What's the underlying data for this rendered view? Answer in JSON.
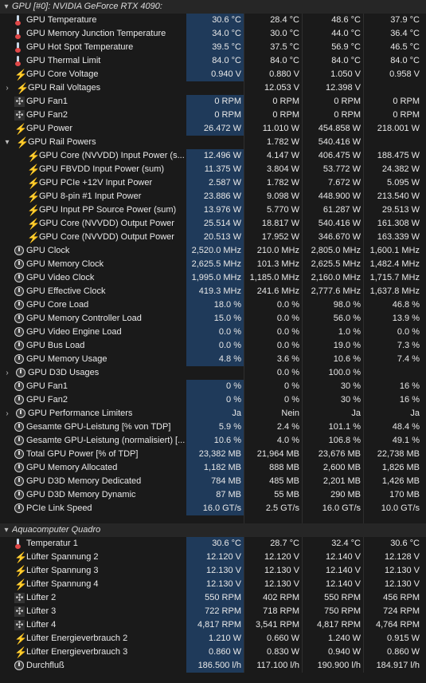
{
  "icons": {
    "temp": "thermometer-icon",
    "volt": "lightning-bolt-icon",
    "fan": "fan-icon",
    "clock": "clock-icon",
    "chevron_down": "chevron-down-icon",
    "chevron_right": "chevron-right-icon"
  },
  "colors": {
    "background": "#1a1a1a",
    "current_highlight": "#1f3a5a",
    "bolt": "#f2c300",
    "thermo_bulb": "#e04848"
  },
  "rows": [
    {
      "t": "sec",
      "lvl": 0,
      "exp": "▾",
      "name": "GPU [#0]: NVIDIA GeForce RTX 4090:"
    },
    {
      "t": "r",
      "lvl": 1,
      "icon": "temp",
      "name": "GPU Temperature",
      "v": [
        "30.6 °C",
        "28.4 °C",
        "48.6 °C",
        "37.9 °C"
      ]
    },
    {
      "t": "r",
      "lvl": 1,
      "icon": "temp",
      "name": "GPU Memory Junction Temperature",
      "v": [
        "34.0 °C",
        "30.0 °C",
        "44.0 °C",
        "36.4 °C"
      ]
    },
    {
      "t": "r",
      "lvl": 1,
      "icon": "temp",
      "name": "GPU Hot Spot Temperature",
      "v": [
        "39.5 °C",
        "37.5 °C",
        "56.9 °C",
        "46.5 °C"
      ]
    },
    {
      "t": "r",
      "lvl": 1,
      "icon": "temp",
      "name": "GPU Thermal Limit",
      "v": [
        "84.0 °C",
        "84.0 °C",
        "84.0 °C",
        "84.0 °C"
      ]
    },
    {
      "t": "r",
      "lvl": 1,
      "icon": "volt",
      "name": "GPU Core Voltage",
      "v": [
        "0.940 V",
        "0.880 V",
        "1.050 V",
        "0.958 V"
      ]
    },
    {
      "t": "r",
      "lvl": 1,
      "exp": "›",
      "icon": "volt",
      "name": "GPU Rail Voltages",
      "v": [
        "",
        "12.053 V",
        "12.398 V",
        ""
      ]
    },
    {
      "t": "r",
      "lvl": 1,
      "icon": "fan",
      "name": "GPU Fan1",
      "v": [
        "0 RPM",
        "0 RPM",
        "0 RPM",
        "0 RPM"
      ]
    },
    {
      "t": "r",
      "lvl": 1,
      "icon": "fan",
      "name": "GPU Fan2",
      "v": [
        "0 RPM",
        "0 RPM",
        "0 RPM",
        "0 RPM"
      ]
    },
    {
      "t": "r",
      "lvl": 1,
      "icon": "volt",
      "name": "GPU Power",
      "v": [
        "26.472 W",
        "11.010 W",
        "454.858 W",
        "218.001 W"
      ]
    },
    {
      "t": "r",
      "lvl": 1,
      "exp": "▾",
      "icon": "volt",
      "name": "GPU Rail Powers",
      "v": [
        "",
        "1.782 W",
        "540.416 W",
        ""
      ]
    },
    {
      "t": "r",
      "lvl": 2,
      "icon": "volt",
      "name": "GPU Core (NVVDD) Input Power (s...",
      "v": [
        "12.496 W",
        "4.147 W",
        "406.475 W",
        "188.475 W"
      ]
    },
    {
      "t": "r",
      "lvl": 2,
      "icon": "volt",
      "name": "GPU FBVDD Input Power (sum)",
      "v": [
        "11.375 W",
        "3.804 W",
        "53.772 W",
        "24.382 W"
      ]
    },
    {
      "t": "r",
      "lvl": 2,
      "icon": "volt",
      "name": "GPU PCIe +12V Input Power",
      "v": [
        "2.587 W",
        "1.782 W",
        "7.672 W",
        "5.095 W"
      ]
    },
    {
      "t": "r",
      "lvl": 2,
      "icon": "volt",
      "name": "GPU 8-pin #1 Input Power",
      "v": [
        "23.886 W",
        "9.098 W",
        "448.900 W",
        "213.540 W"
      ]
    },
    {
      "t": "r",
      "lvl": 2,
      "icon": "volt",
      "name": "GPU Input PP Source Power (sum)",
      "v": [
        "13.976 W",
        "5.770 W",
        "61.287 W",
        "29.513 W"
      ]
    },
    {
      "t": "r",
      "lvl": 2,
      "icon": "volt",
      "name": "GPU Core (NVVDD) Output Power",
      "v": [
        "25.514 W",
        "18.817 W",
        "540.416 W",
        "161.308 W"
      ]
    },
    {
      "t": "r",
      "lvl": 2,
      "icon": "volt",
      "name": "GPU Core (NVVDD) Output Power",
      "v": [
        "20.513 W",
        "17.952 W",
        "346.670 W",
        "163.339 W"
      ]
    },
    {
      "t": "r",
      "lvl": 1,
      "icon": "clock",
      "name": "GPU Clock",
      "v": [
        "2,520.0 MHz",
        "210.0 MHz",
        "2,805.0 MHz",
        "1,600.1 MHz"
      ]
    },
    {
      "t": "r",
      "lvl": 1,
      "icon": "clock",
      "name": "GPU Memory Clock",
      "v": [
        "2,625.5 MHz",
        "101.3 MHz",
        "2,625.5 MHz",
        "1,482.4 MHz"
      ]
    },
    {
      "t": "r",
      "lvl": 1,
      "icon": "clock",
      "name": "GPU Video Clock",
      "v": [
        "1,995.0 MHz",
        "1,185.0 MHz",
        "2,160.0 MHz",
        "1,715.7 MHz"
      ]
    },
    {
      "t": "r",
      "lvl": 1,
      "icon": "clock",
      "name": "GPU Effective Clock",
      "v": [
        "419.3 MHz",
        "241.6 MHz",
        "2,777.6 MHz",
        "1,637.8 MHz"
      ]
    },
    {
      "t": "r",
      "lvl": 1,
      "icon": "clock",
      "name": "GPU Core Load",
      "v": [
        "18.0 %",
        "0.0 %",
        "98.0 %",
        "46.8 %"
      ]
    },
    {
      "t": "r",
      "lvl": 1,
      "icon": "clock",
      "name": "GPU Memory Controller Load",
      "v": [
        "15.0 %",
        "0.0 %",
        "56.0 %",
        "13.9 %"
      ]
    },
    {
      "t": "r",
      "lvl": 1,
      "icon": "clock",
      "name": "GPU Video Engine Load",
      "v": [
        "0.0 %",
        "0.0 %",
        "1.0 %",
        "0.0 %"
      ]
    },
    {
      "t": "r",
      "lvl": 1,
      "icon": "clock",
      "name": "GPU Bus Load",
      "v": [
        "0.0 %",
        "0.0 %",
        "19.0 %",
        "7.3 %"
      ]
    },
    {
      "t": "r",
      "lvl": 1,
      "icon": "clock",
      "name": "GPU Memory Usage",
      "v": [
        "4.8 %",
        "3.6 %",
        "10.6 %",
        "7.4 %"
      ]
    },
    {
      "t": "r",
      "lvl": 1,
      "exp": "›",
      "icon": "clock",
      "name": "GPU D3D Usages",
      "v": [
        "",
        "0.0 %",
        "100.0 %",
        ""
      ]
    },
    {
      "t": "r",
      "lvl": 1,
      "icon": "clock",
      "name": "GPU Fan1",
      "v": [
        "0 %",
        "0 %",
        "30 %",
        "16 %"
      ]
    },
    {
      "t": "r",
      "lvl": 1,
      "icon": "clock",
      "name": "GPU Fan2",
      "v": [
        "0 %",
        "0 %",
        "30 %",
        "16 %"
      ]
    },
    {
      "t": "r",
      "lvl": 1,
      "exp": "›",
      "icon": "clock",
      "name": "GPU Performance Limiters",
      "v": [
        "Ja",
        "Nein",
        "Ja",
        "Ja"
      ]
    },
    {
      "t": "r",
      "lvl": 1,
      "icon": "clock",
      "name": "Gesamte GPU-Leistung [% von TDP]",
      "v": [
        "5.9 %",
        "2.4 %",
        "101.1 %",
        "48.4 %"
      ]
    },
    {
      "t": "r",
      "lvl": 1,
      "icon": "clock",
      "name": "Gesamte GPU-Leistung (normalisiert) [...",
      "v": [
        "10.6 %",
        "4.0 %",
        "106.8 %",
        "49.1 %"
      ]
    },
    {
      "t": "r",
      "lvl": 1,
      "icon": "clock",
      "name": "Total GPU Power [% of TDP]",
      "v": [
        "23,382 MB",
        "21,964 MB",
        "23,676 MB",
        "22,738 MB"
      ]
    },
    {
      "t": "r",
      "lvl": 1,
      "icon": "clock",
      "name": "GPU Memory Allocated",
      "v": [
        "1,182 MB",
        "888 MB",
        "2,600 MB",
        "1,826 MB"
      ]
    },
    {
      "t": "r",
      "lvl": 1,
      "icon": "clock",
      "name": "GPU D3D Memory Dedicated",
      "v": [
        "784 MB",
        "485 MB",
        "2,201 MB",
        "1,426 MB"
      ]
    },
    {
      "t": "r",
      "lvl": 1,
      "icon": "clock",
      "name": "GPU D3D Memory Dynamic",
      "v": [
        "87 MB",
        "55 MB",
        "290 MB",
        "170 MB"
      ]
    },
    {
      "t": "r",
      "lvl": 1,
      "icon": "clock",
      "name": "PCIe Link Speed",
      "v": [
        "16.0 GT/s",
        "2.5 GT/s",
        "16.0 GT/s",
        "10.0 GT/s"
      ]
    },
    {
      "t": "blank"
    },
    {
      "t": "sec",
      "lvl": 0,
      "exp": "▾",
      "name": "Aquacomputer Quadro"
    },
    {
      "t": "r",
      "lvl": 1,
      "icon": "temp",
      "name": "Temperatur 1",
      "v": [
        "30.6 °C",
        "28.7 °C",
        "32.4 °C",
        "30.6 °C"
      ]
    },
    {
      "t": "r",
      "lvl": 1,
      "icon": "volt",
      "name": "Lüfter Spannung 2",
      "v": [
        "12.120 V",
        "12.120 V",
        "12.140 V",
        "12.128 V"
      ]
    },
    {
      "t": "r",
      "lvl": 1,
      "icon": "volt",
      "name": "Lüfter Spannung 3",
      "v": [
        "12.130 V",
        "12.130 V",
        "12.140 V",
        "12.130 V"
      ]
    },
    {
      "t": "r",
      "lvl": 1,
      "icon": "volt",
      "name": "Lüfter Spannung 4",
      "v": [
        "12.130 V",
        "12.130 V",
        "12.140 V",
        "12.130 V"
      ]
    },
    {
      "t": "r",
      "lvl": 1,
      "icon": "fan",
      "name": "Lüfter 2",
      "v": [
        "550 RPM",
        "402 RPM",
        "550 RPM",
        "456 RPM"
      ]
    },
    {
      "t": "r",
      "lvl": 1,
      "icon": "fan",
      "name": "Lüfter 3",
      "v": [
        "722 RPM",
        "718 RPM",
        "750 RPM",
        "724 RPM"
      ]
    },
    {
      "t": "r",
      "lvl": 1,
      "icon": "fan",
      "name": "Lüfter 4",
      "v": [
        "4,817 RPM",
        "3,541 RPM",
        "4,817 RPM",
        "4,764 RPM"
      ]
    },
    {
      "t": "r",
      "lvl": 1,
      "icon": "volt",
      "name": "Lüfter Energieverbrauch 2",
      "v": [
        "1.210 W",
        "0.660 W",
        "1.240 W",
        "0.915 W"
      ]
    },
    {
      "t": "r",
      "lvl": 1,
      "icon": "volt",
      "name": "Lüfter Energieverbrauch 3",
      "v": [
        "0.860 W",
        "0.830 W",
        "0.940 W",
        "0.860 W"
      ]
    },
    {
      "t": "r",
      "lvl": 1,
      "icon": "clock",
      "name": "Durchfluß",
      "v": [
        "186.500 l/h",
        "117.100 l/h",
        "190.900 l/h",
        "184.917 l/h"
      ]
    }
  ]
}
